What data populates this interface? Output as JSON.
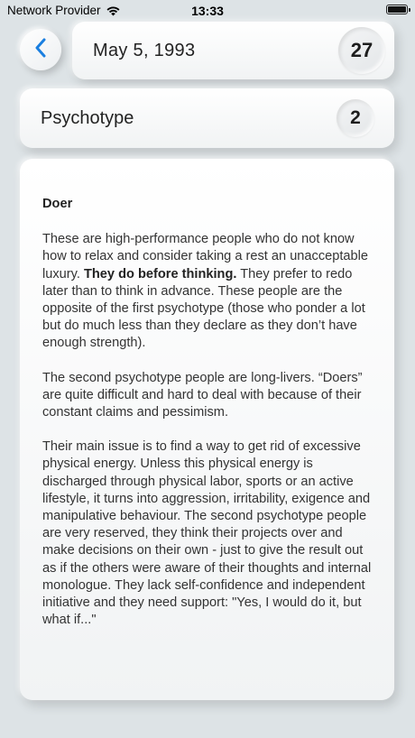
{
  "status_bar": {
    "carrier": "Network Provider",
    "time": "13:33",
    "wifi_icon": "wifi-icon",
    "battery_icon": "battery-full-icon"
  },
  "header": {
    "back_icon": "chevron-left-icon",
    "accent_color": "#1a7fe0",
    "date": "May 5, 1993",
    "date_number": "27"
  },
  "psychotype": {
    "label": "Psychotype",
    "number": "2"
  },
  "content": {
    "title": "Doer",
    "p1_part1": "These are high-performance people who do not know how to relax and consider taking a rest an unacceptable luxury. ",
    "p1_bold": "They do before thinking.",
    "p1_part2": " They prefer to redo later than to think in advance. These people are the opposite of the first psychotype (those who ponder a lot but do much less than they declare as they don’t have enough strength).",
    "p2": "The second psychotype people are long-livers. “Doers” are quite difficult and hard to deal with because of their constant claims and pessimism.",
    "p3": "Their main issue is to find a way to get rid of excessive physical energy. Unless this physical energy is discharged through physical labor, sports or an active lifestyle, it turns into aggression, irritability, exigence and manipulative behaviour. The second psychotype people are very reserved, they think their projects over and make decisions on their own - just to give the result out as if the others were aware of their thoughts and internal monologue. They lack self-confidence and independent initiative and they need support: \"Yes, I would do it, but what if...\""
  }
}
